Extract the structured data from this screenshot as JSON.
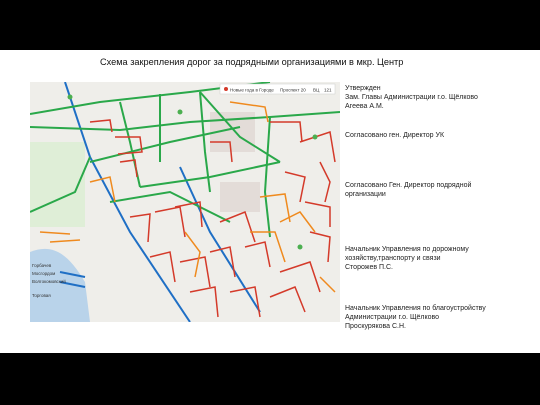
{
  "slide_title": "Схема закрепления дорог за подрядными организациями в мкр. Центр",
  "approvals": [
    {
      "text": "Утвержден\nЗам. Главы Администрации г.о. Щёлково\nАгеева А.М."
    },
    {
      "text": "Согласовано ген. Директор УК"
    },
    {
      "text": "Согласовано Ген. Директор подрядной\nорганизации"
    },
    {
      "text": "Начальник Управления по дорожному\nхозяйству,транспорту и связи\nСторожев П.С."
    },
    {
      "text": "Начальник Управления по благоустройству\nАдминистрации г.о. Щёлково\nПроскурякова С.Н."
    }
  ],
  "map": {
    "legend": [
      "Новые года в Городе",
      "Проспект 20",
      "ВЦ",
      "121"
    ],
    "side_labels": [
      "Горбачев",
      "Мосгордом",
      "Волгокомовский",
      "Торговая"
    ],
    "colors": {
      "green_road": "#2aa84a",
      "blue_road": "#1f6fc5",
      "red_road": "#d43a2a",
      "orange_road": "#ef8a1e",
      "water": "#b9d3ea",
      "park": "#cfe6c2"
    }
  }
}
